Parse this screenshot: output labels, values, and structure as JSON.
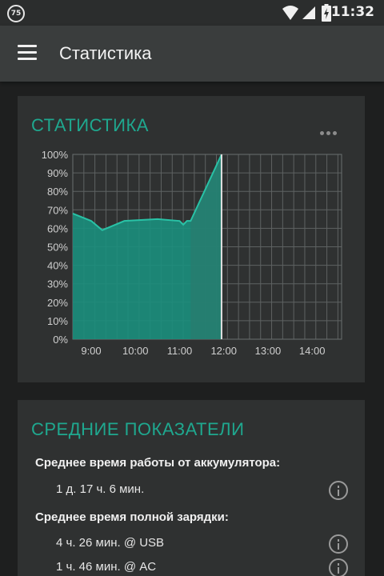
{
  "status_bar": {
    "badge": "75",
    "time": "11:32"
  },
  "app_bar": {
    "title": "Статистика",
    "menu_icon": "hamburger-menu-icon"
  },
  "stats_card": {
    "title": "СТАТИСТИКА",
    "menu_icon": "more-horizontal-icon"
  },
  "chart_data": {
    "type": "area",
    "y_tick_labels": [
      "100%",
      "90%",
      "80%",
      "70%",
      "60%",
      "50%",
      "40%",
      "30%",
      "20%",
      "10%",
      "0%"
    ],
    "x_tick_labels": [
      "9:00",
      "10:00",
      "11:00",
      "12:00",
      "13:00",
      "14:00"
    ],
    "ylim": [
      0,
      100
    ],
    "xlim": [
      "8:35",
      "14:40"
    ],
    "grid": true,
    "series": [
      {
        "values": [
          {
            "x": "8:35",
            "y": 68
          },
          {
            "x": "9:00",
            "y": 64
          },
          {
            "x": "9:15",
            "y": 59
          },
          {
            "x": "9:45",
            "y": 64
          },
          {
            "x": "10:30",
            "y": 65
          },
          {
            "x": "11:00",
            "y": 64
          },
          {
            "x": "11:05",
            "y": 62
          },
          {
            "x": "11:10",
            "y": 64
          },
          {
            "x": "11:15",
            "y": 64
          },
          {
            "x": "11:57",
            "y": 100
          }
        ]
      }
    ],
    "colors": {
      "fill": "#1b8f7d",
      "line": "#29c2a6",
      "current_marker": "#e0e0e0"
    },
    "current_time": "11:57"
  },
  "averages_card": {
    "title": "СРЕДНИЕ ПОКАЗАТЕЛИ",
    "battery_heading": "Среднее время работы от аккумулятора:",
    "battery_value": "1 д. 17 ч. 6 мин.",
    "charge_heading": "Среднее время полной зарядки:",
    "charge_usb": "4 ч. 26 мин. @ USB",
    "charge_ac": "1 ч. 46 мин. @ AC"
  }
}
